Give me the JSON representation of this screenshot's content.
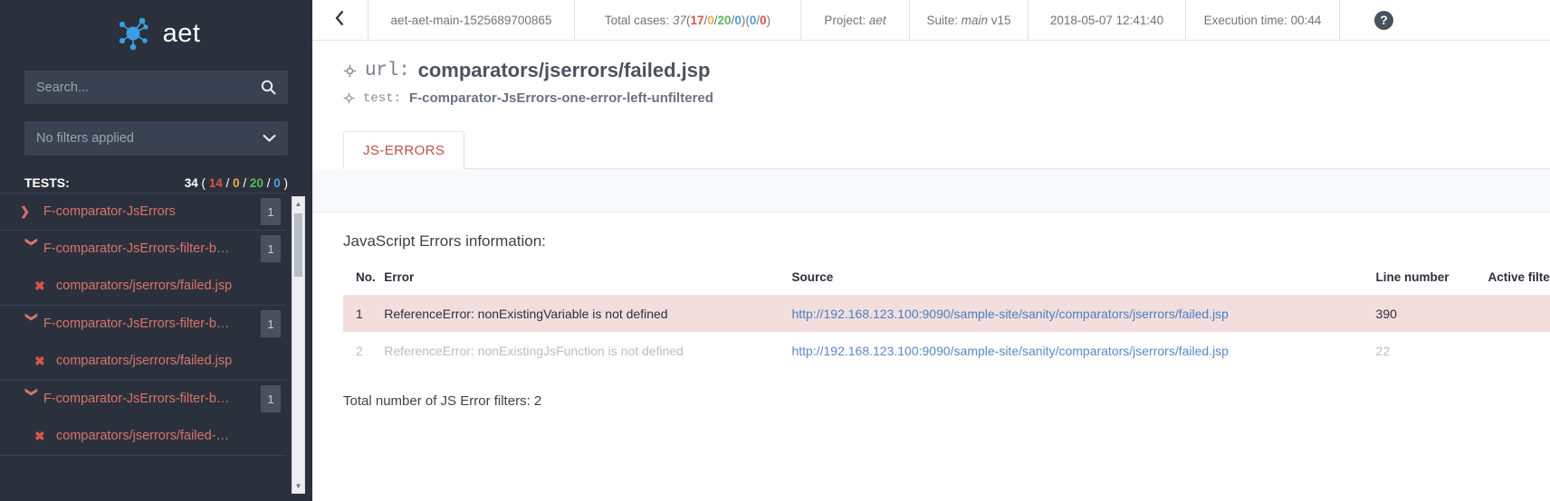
{
  "sidebar": {
    "brand": {
      "name": "aet",
      "logo_icon": "aet-network-logo"
    },
    "search": {
      "placeholder": "Search...",
      "value": "",
      "icon": "search-icon"
    },
    "filter": {
      "label": "No filters applied",
      "icon": "chevron-down-icon"
    },
    "tests_header": {
      "label": "TESTS:",
      "total": "34",
      "open_paren": "(",
      "failed": "14",
      "sep": "/",
      "warning": "0",
      "passed": "20",
      "info": "0",
      "close_paren": ")"
    },
    "groups": [
      {
        "caret_icon": "chevron-right-icon",
        "label": "F-comparator-JsErrors",
        "badge": "1",
        "expanded": false,
        "children": []
      },
      {
        "caret_icon": "chevron-down-icon",
        "label": "F-comparator-JsErrors-filter-b…",
        "badge": "1",
        "expanded": true,
        "children": [
          {
            "status_icon": "failed-x-icon",
            "label": "comparators/jserrors/failed.jsp"
          }
        ]
      },
      {
        "caret_icon": "chevron-down-icon",
        "label": "F-comparator-JsErrors-filter-b…",
        "badge": "1",
        "expanded": true,
        "children": [
          {
            "status_icon": "failed-x-icon",
            "label": "comparators/jserrors/failed.jsp"
          }
        ]
      },
      {
        "caret_icon": "chevron-down-icon",
        "label": "F-comparator-JsErrors-filter-b…",
        "badge": "1",
        "expanded": true,
        "children": [
          {
            "status_icon": "failed-x-icon",
            "label": "comparators/jserrors/failed-…"
          }
        ]
      }
    ],
    "scrollbar": {
      "up_icon": "caret-up-icon",
      "down_icon": "caret-down-icon"
    }
  },
  "topbar": {
    "back_icon": "chevron-left-icon",
    "run_id": "aet-aet-main-1525689700865",
    "cases": {
      "label": "Total cases:",
      "total": "37",
      "open": "(",
      "failed": "17",
      "warning": "0",
      "passed": "20",
      "info": "0",
      "close": ")",
      "open2": "(",
      "rebase": "0",
      "rebase2": "0",
      "close2": ")",
      "sep": "/"
    },
    "project": {
      "label": "Project:",
      "value": "aet"
    },
    "suite": {
      "label": "Suite:",
      "value": "main",
      "version": "v15"
    },
    "timestamp": "2018-05-07 12:41:40",
    "execution": {
      "label": "Execution time:",
      "value": "00:44"
    },
    "help_icon": "help-question-icon",
    "help_glyph": "?"
  },
  "page": {
    "url_icon": "crosshair-target-icon",
    "url_key": "url:",
    "url_value": "comparators/jserrors/failed.jsp",
    "test_icon": "crosshair-target-icon",
    "test_key": "test:",
    "test_value": "F-comparator-JsErrors-one-error-left-unfiltered",
    "prev_icon": "chevron-left-icon",
    "next_icon": "chevron-right-icon",
    "comment_icon": "comment-pencil-icon",
    "tabs": [
      {
        "label": "JS-ERRORS",
        "active": true
      }
    ],
    "subbar_comment_icon": "comment-pencil-icon"
  },
  "errors_panel": {
    "title": "JavaScript Errors information:",
    "columns": [
      "No.",
      "Error",
      "Source",
      "Line number",
      "Active filters information"
    ],
    "rows": [
      {
        "no": "1",
        "error": "ReferenceError: nonExistingVariable is not defined",
        "source": "http://192.168.123.100:9090/sample-site/sanity/comparators/jserrors/failed.jsp",
        "line": "390",
        "filters": "",
        "filters_icon": "",
        "state": "active"
      },
      {
        "no": "2",
        "error": "ReferenceError: nonExistingJsFunction is not defined",
        "source": "http://192.168.123.100:9090/sample-site/sanity/comparators/jserrors/failed.jsp",
        "line": "22",
        "filters": "",
        "filters_icon": "info-circle-icon",
        "state": "muted"
      }
    ],
    "total_line": "Total number of JS Error filters: 2"
  },
  "colors": {
    "sidebar_bg": "#2b313c",
    "accent_blue": "#3c9ee5",
    "failed_red": "#d9534f",
    "warning_orange": "#f0ad4e",
    "passed_green": "#5cb85c",
    "info_blue": "#4a9fe0",
    "tab_red": "#c0504a",
    "row_highlight": "#f3dede",
    "link_blue": "#4a7fc1"
  }
}
